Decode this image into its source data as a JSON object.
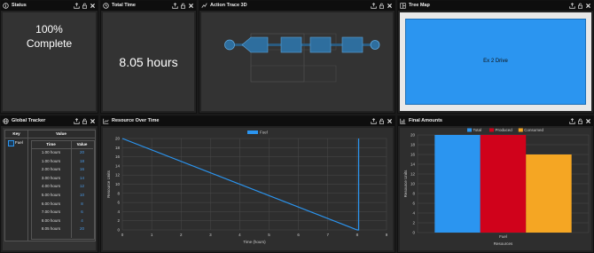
{
  "panels": {
    "status": {
      "title": "Status",
      "line1": "100%",
      "line2": "Complete"
    },
    "total_time": {
      "title": "Total Time",
      "value": "8.05 hours"
    },
    "action_trace": {
      "title": "Action Trace 3D"
    },
    "tree_map": {
      "title": "Tree Map",
      "label": "Ex 2 Drive"
    },
    "global_tracker": {
      "title": "Global Tracker",
      "columns": {
        "key": "Key",
        "value": "Value",
        "time": "Time",
        "val": "Value"
      },
      "key_label": "Fuel",
      "rows": [
        {
          "time": "1.00 hours",
          "value": "20"
        },
        {
          "time": "1.00 hours",
          "value": "18"
        },
        {
          "time": "2.00 hours",
          "value": "16"
        },
        {
          "time": "3.00 hours",
          "value": "14"
        },
        {
          "time": "4.00 hours",
          "value": "12"
        },
        {
          "time": "5.00 hours",
          "value": "10"
        },
        {
          "time": "6.00 hours",
          "value": "8"
        },
        {
          "time": "7.00 hours",
          "value": "6"
        },
        {
          "time": "8.00 hours",
          "value": "4"
        },
        {
          "time": "8.05 hours",
          "value": "20"
        }
      ]
    },
    "resource_over_time": {
      "title": "Resource Over Time"
    },
    "final_amounts": {
      "title": "Final Amounts"
    }
  },
  "colors": {
    "accent": "#2b95f0",
    "produced": "#d0021b",
    "consumed": "#f5a623",
    "link": "#4a9be8"
  },
  "chart_data": [
    {
      "type": "line",
      "legend": [
        "Fuel"
      ],
      "legend_position": "top",
      "xlabel": "Time (hours)",
      "ylabel": "Resource Units",
      "xlim": [
        0,
        9
      ],
      "ylim": [
        0,
        20
      ],
      "xticks": [
        "0",
        "1",
        "2",
        "3",
        "4",
        "5",
        "6",
        "7",
        "8",
        "9"
      ],
      "yticks": [
        "0",
        "2",
        "4",
        "6",
        "8",
        "10",
        "12",
        "14",
        "16",
        "18",
        "20"
      ],
      "grid": true,
      "series": [
        {
          "name": "Fuel",
          "x": [
            0,
            8,
            8.05,
            8.05
          ],
          "y": [
            20,
            0,
            0,
            20
          ]
        }
      ]
    },
    {
      "type": "bar",
      "categories": [
        "Fuel"
      ],
      "xlabel": "Resources",
      "ylabel": "Resource Units",
      "ylim": [
        0,
        20
      ],
      "yticks": [
        "0",
        "2",
        "4",
        "6",
        "8",
        "10",
        "12",
        "14",
        "16",
        "18",
        "20"
      ],
      "legend_position": "top",
      "grid": true,
      "series": [
        {
          "name": "Total",
          "values": [
            20
          ]
        },
        {
          "name": "Produced",
          "values": [
            20
          ]
        },
        {
          "name": "Consumed",
          "values": [
            16
          ]
        }
      ]
    }
  ]
}
